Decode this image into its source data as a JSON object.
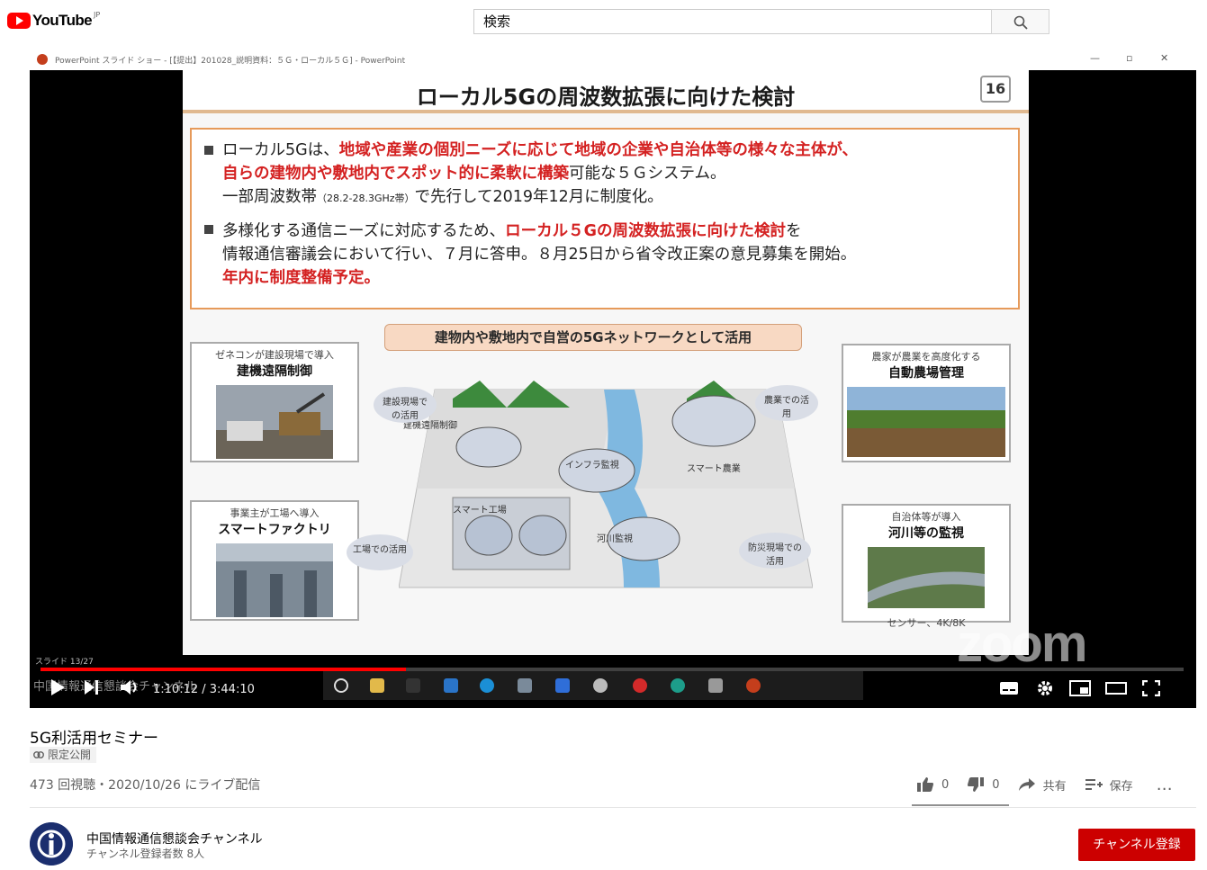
{
  "header": {
    "logo_text": "YouTube",
    "logo_country": "JP",
    "search_placeholder": "検索"
  },
  "player": {
    "window_title": "PowerPoint スライド ショー - [【提出】201028_説明資料：５Ｇ・ローカル５Ｇ] - PowerPoint",
    "window_controls": [
      "—",
      "▫",
      "✕"
    ],
    "slide": {
      "title": "ローカル5Gの周波数拡張に向けた検討",
      "number": "16",
      "bullets": [
        {
          "lines": [
            [
              {
                "t": "ローカル5Gは、",
                "r": false
              },
              {
                "t": "地域や産業の個別ニーズに応じて地域の企業や自治体等の様々な主体が、",
                "r": true
              }
            ],
            [
              {
                "t": "自らの建物内や敷地内でスポット的に柔軟に構築",
                "r": true
              },
              {
                "t": "可能な５Ｇシステム。",
                "r": false
              }
            ],
            [
              {
                "t": "一部周波数帯",
                "r": false
              },
              {
                "t": "（28.2-28.3GHz帯）",
                "r": false,
                "s": true
              },
              {
                "t": "で先行して2019年12月に制度化。",
                "r": false
              }
            ]
          ]
        },
        {
          "lines": [
            [
              {
                "t": "多様化する通信ニーズに対応するため、",
                "r": false
              },
              {
                "t": "ローカル５Gの周波数拡張に向けた検討",
                "r": true
              },
              {
                "t": "を",
                "r": false
              }
            ],
            [
              {
                "t": "情報通信審議会において行い、７月に答申。８月25日から省令改正案の意見募集を開始。",
                "r": false
              }
            ],
            [
              {
                "t": "年内に制度整備予定。",
                "r": true
              }
            ]
          ]
        }
      ],
      "banner": "建物内や敷地内で自営の5Gネットワークとして活用",
      "cases": {
        "construction": {
          "sub": "ゼネコンが建設現場で導入",
          "main": "建機遠隔制御"
        },
        "factory": {
          "sub": "事業主が工場へ導入",
          "main": "スマートファクトリ"
        },
        "farm": {
          "sub": "農家が農業を高度化する",
          "main": "自動農場管理"
        },
        "river": {
          "sub": "自治体等が導入",
          "main": "河川等の監視",
          "footer": "センサー、4K/8K"
        }
      },
      "diagram_labels": {
        "site": "建設現場での活用",
        "remote": "建機遠隔制御",
        "infra": "インフラ監視",
        "smart_agri": "スマート農業",
        "agri": "農業での活用",
        "smart_factory": "スマート工場",
        "factory_use": "工場での活用",
        "river": "河川監視",
        "disaster": "防災現場での活用"
      },
      "footer": "スライド 13/27"
    },
    "watermark": "zoom",
    "overlay_text": "中国情報通信懇談会チャンネル",
    "progress_fraction": 0.32,
    "time": "1:10:12 / 3:44:10",
    "icons": [
      "play-icon",
      "next-icon",
      "volume-icon",
      "subtitles-icon",
      "settings-icon",
      "miniplayer-icon",
      "theater-icon",
      "fullscreen-icon"
    ]
  },
  "video": {
    "title": "5G利活用セミナー",
    "privacy": "限定公開",
    "meta": "473 回視聴・2020/10/26 にライブ配信",
    "likes": "0",
    "dislikes": "0",
    "share_label": "共有",
    "save_label": "保存",
    "more": "…"
  },
  "channel": {
    "name": "中国情報通信懇談会チャンネル",
    "subscribers": "チャンネル登録者数 8人",
    "subscribe_label": "チャンネル登録"
  },
  "colors": {
    "brand_red": "#ff0000",
    "subscribe_red": "#cc0000",
    "slide_accent": "#e69a5a",
    "slide_red_text": "#d42222"
  }
}
